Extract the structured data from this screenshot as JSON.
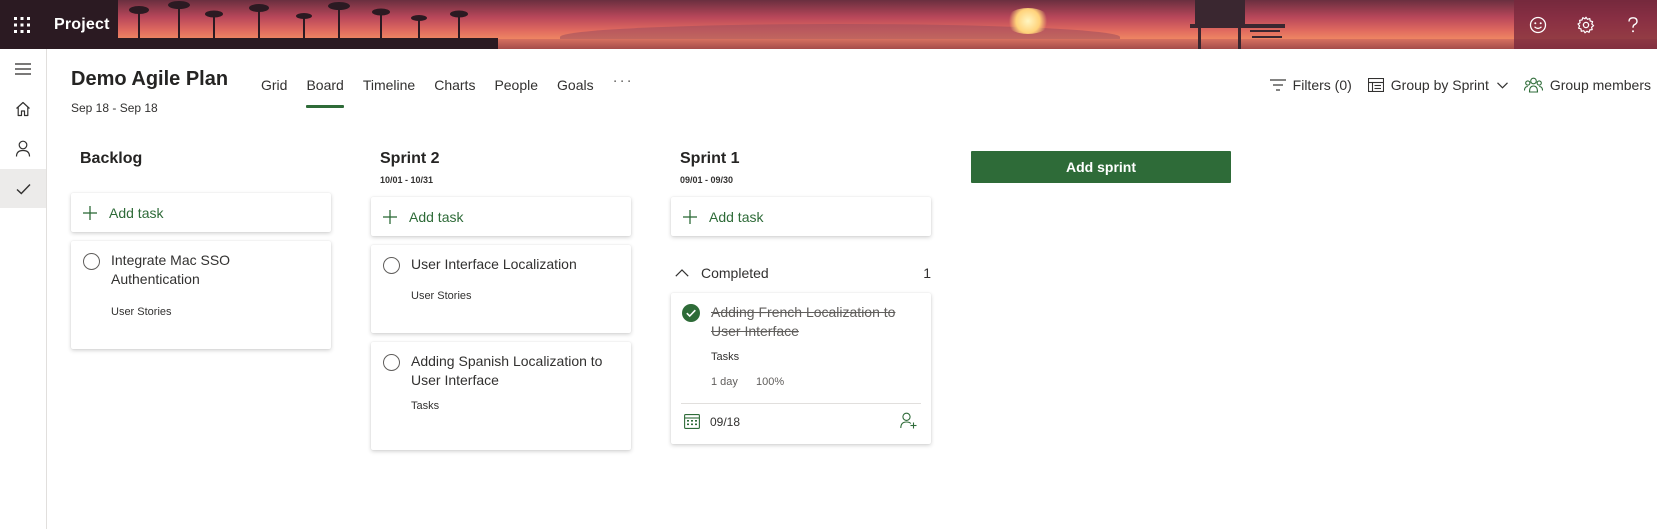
{
  "app": {
    "name": "Project"
  },
  "header": {
    "icons": [
      "waffle-icon",
      "feedback-smile-icon",
      "settings-gear-icon",
      "help-question-icon"
    ]
  },
  "rail": {
    "items": [
      "menu-icon",
      "home-icon",
      "person-icon",
      "check-icon"
    ]
  },
  "plan": {
    "title": "Demo Agile Plan",
    "dates": "Sep 18 - Sep 18"
  },
  "tabs": [
    {
      "label": "Grid"
    },
    {
      "label": "Board",
      "active": true
    },
    {
      "label": "Timeline"
    },
    {
      "label": "Charts"
    },
    {
      "label": "People"
    },
    {
      "label": "Goals"
    },
    {
      "label": "···"
    }
  ],
  "toolbar": {
    "filters": "Filters (0)",
    "group_by": "Group by Sprint",
    "members": "Group members"
  },
  "board": {
    "add_task_label": "Add task",
    "add_sprint_label": "Add sprint",
    "columns": [
      {
        "title": "Backlog",
        "dates": "",
        "cards": [
          {
            "title": "Integrate Mac SSO Authentication",
            "bucket": "User Stories"
          }
        ]
      },
      {
        "title": "Sprint 2",
        "dates": "10/01 - 10/31",
        "cards": [
          {
            "title": "User Interface Localization",
            "bucket": "User Stories"
          },
          {
            "title": "Adding Spanish Localization to User Interface",
            "bucket": "Tasks"
          }
        ]
      },
      {
        "title": "Sprint 1",
        "dates": "09/01 - 09/30",
        "completed": {
          "label": "Completed",
          "count": "1",
          "cards": [
            {
              "title": "Adding French Localization to User Interface",
              "bucket": "Tasks",
              "duration": "1 day",
              "progress": "100%",
              "due": "09/18"
            }
          ]
        }
      }
    ]
  },
  "colors": {
    "accent": "#2e6b38",
    "text": "#323130"
  }
}
